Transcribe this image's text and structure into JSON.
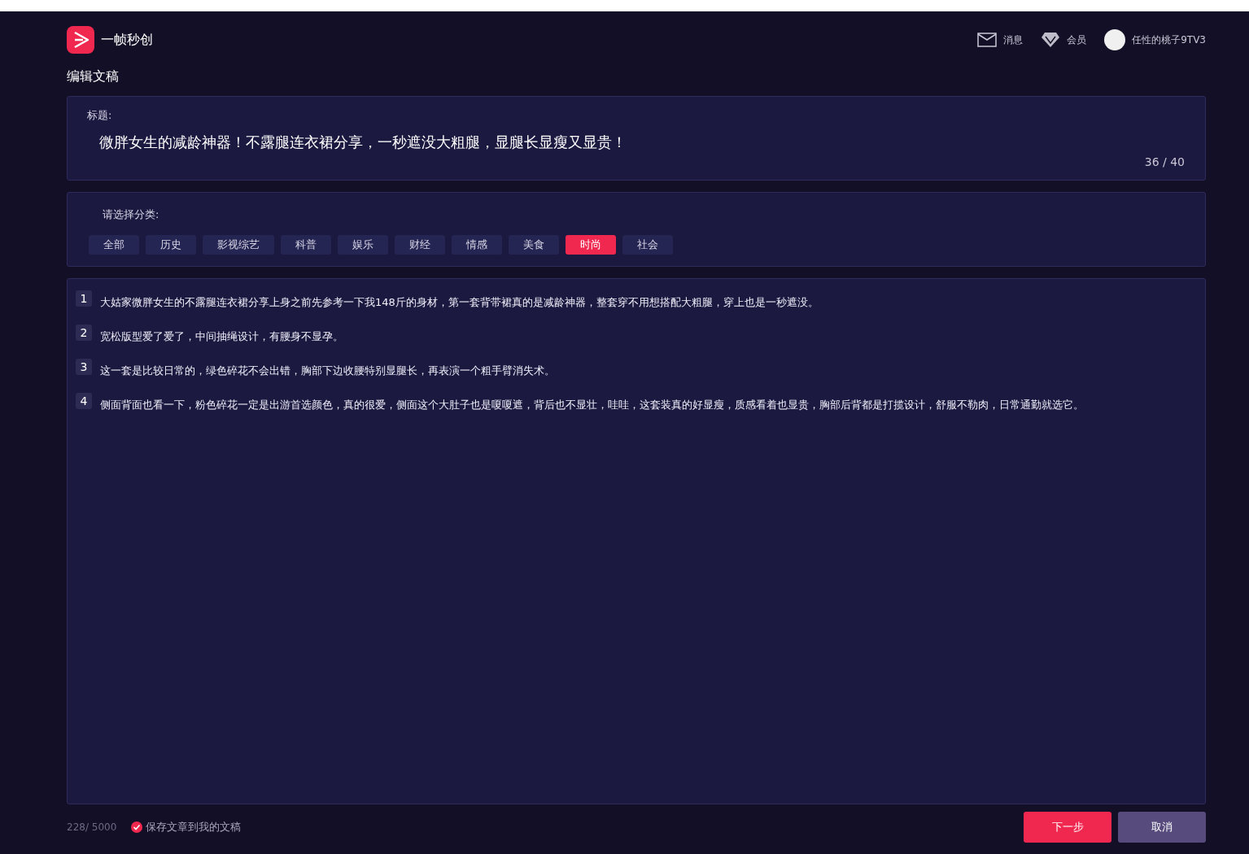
{
  "header": {
    "app_name": "一帧秒创",
    "messages": "消息",
    "membership": "会员",
    "username": "任性的桃子9TV3"
  },
  "page_title": "编辑文稿",
  "title_card": {
    "label": "标题:",
    "value": "微胖女生的减龄神器！不露腿连衣裙分享，一秒遮没大粗腿，显腿长显瘦又显贵！",
    "count": "36 / 40"
  },
  "category_card": {
    "label": "请选择分类:",
    "categories": [
      {
        "label": "全部",
        "selected": false
      },
      {
        "label": "历史",
        "selected": false
      },
      {
        "label": "影视综艺",
        "selected": false
      },
      {
        "label": "科普",
        "selected": false
      },
      {
        "label": "娱乐",
        "selected": false
      },
      {
        "label": "财经",
        "selected": false
      },
      {
        "label": "情感",
        "selected": false
      },
      {
        "label": "美食",
        "selected": false
      },
      {
        "label": "时尚",
        "selected": true
      },
      {
        "label": "社会",
        "selected": false
      }
    ]
  },
  "paragraphs": [
    {
      "number": "1",
      "text": "大姑家微胖女生的不露腿连衣裙分享上身之前先参考一下我148斤的身材，第一套背带裙真的是减龄神器，整套穿不用想搭配大粗腿，穿上也是一秒遮没。"
    },
    {
      "number": "2",
      "text": "宽松版型爱了爱了，中间抽绳设计，有腰身不显孕。"
    },
    {
      "number": "3",
      "text": "这一套是比较日常的，绿色碎花不会出错，胸部下边收腰特别显腿长，再表演一个粗手臂消失术。"
    },
    {
      "number": "4",
      "text": "侧面背面也看一下，粉色碎花一定是出游首选颜色，真的很爱，侧面这个大肚子也是嗄嗄遮，背后也不显壮，哇哇，这套装真的好显瘦，质感看着也显贵，胸部后背都是打揽设计，舒服不勒肉，日常通勤就选它。"
    }
  ],
  "footer": {
    "word_count": "228/ 5000",
    "save_option": {
      "label": "保存文章到我的文稿",
      "checked": true
    },
    "next_button": "下一步",
    "cancel_button": "取消"
  }
}
